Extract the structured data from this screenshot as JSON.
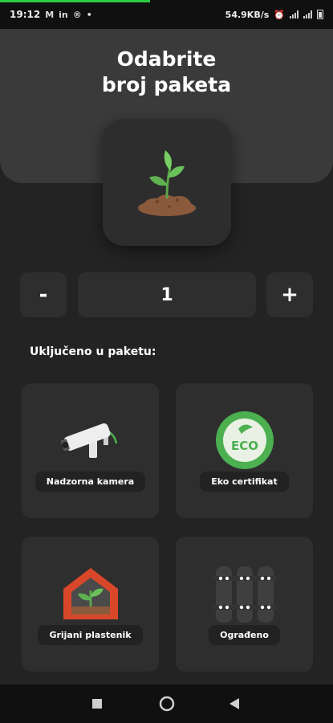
{
  "status_bar": {
    "time": "19:12",
    "network_speed": "54.9KB/s",
    "progress": 0.45
  },
  "header": {
    "title_line1": "Odabrite",
    "title_line2": "broj paketa"
  },
  "quantity": {
    "minus_label": "-",
    "value": "1",
    "plus_label": "+"
  },
  "included": {
    "title": "Uključeno u paketu:",
    "items": [
      {
        "label": "Nadzorna kamera",
        "icon": "security-camera-icon"
      },
      {
        "label": "Eko certifikat",
        "icon": "eco-badge-icon",
        "badge_text": "ECO"
      },
      {
        "label": "Grijani plastenik",
        "icon": "greenhouse-icon"
      },
      {
        "label": "Ograđeno",
        "icon": "fence-icon"
      }
    ]
  },
  "colors": {
    "background": "#232323",
    "header": "#3a3a3a",
    "card": "#2e2e2e",
    "accent_green": "#4caf50",
    "greenhouse_red": "#d9472b"
  }
}
